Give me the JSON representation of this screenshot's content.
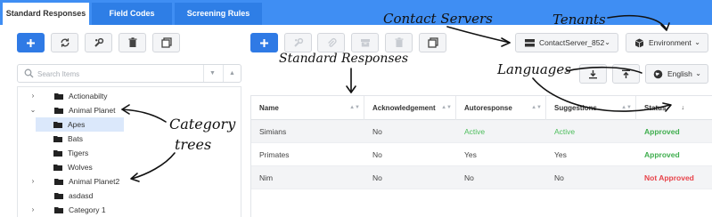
{
  "tabs": [
    "Standard Responses",
    "Field Codes",
    "Screening Rules"
  ],
  "search": {
    "placeholder": "Search Items"
  },
  "tree": [
    {
      "label": "Actionabilty",
      "expanded": false,
      "level": 0
    },
    {
      "label": "Animal Planet",
      "expanded": true,
      "level": 0
    },
    {
      "label": "Apes",
      "level": 1,
      "selected": true
    },
    {
      "label": "Bats",
      "level": 1
    },
    {
      "label": "Tigers",
      "level": 1
    },
    {
      "label": "Wolves",
      "level": 1
    },
    {
      "label": "Animal Planet2",
      "expanded": false,
      "level": 0
    },
    {
      "label": "asdasd",
      "level": 0
    },
    {
      "label": "Category 1",
      "expanded": false,
      "level": 0
    }
  ],
  "toolbar": {
    "contact_server": "ContactServer_852",
    "tenant": "Environment",
    "language": "English"
  },
  "table": {
    "headers": [
      "Name",
      "Acknowledgement",
      "Autoresponse",
      "Suggestions",
      "Status"
    ],
    "rows": [
      [
        "Simians",
        "No",
        "Active",
        "Active",
        "Approved"
      ],
      [
        "Primates",
        "No",
        "Yes",
        "Yes",
        "Approved"
      ],
      [
        "Nim",
        "No",
        "No",
        "No",
        "Not Approved"
      ]
    ]
  },
  "callouts": {
    "contact_servers": "Contact Servers",
    "tenants": "Tenants",
    "standard_responses": "Standard Responses",
    "languages": "Languages",
    "category_trees_line1": "Category",
    "category_trees_line2": "trees"
  },
  "colors": {
    "tab_bar": "#3f8ef3",
    "primary": "#2f7ae5",
    "approved": "#3fae4e",
    "not_approved": "#e8434a",
    "active": "#4cbe5c"
  }
}
